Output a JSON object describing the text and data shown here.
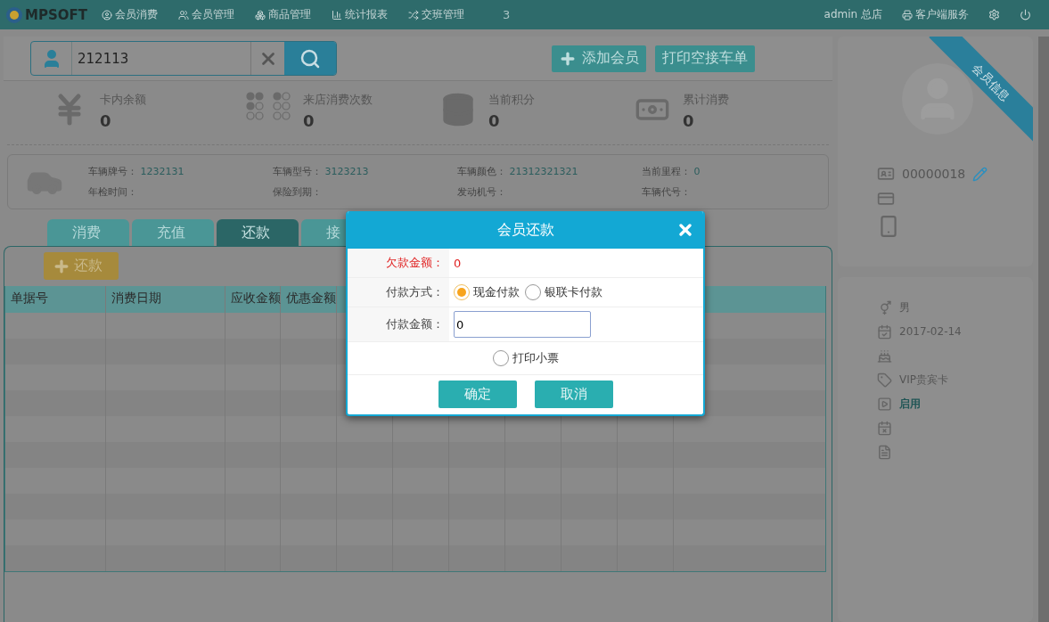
{
  "nav": {
    "logo": "MPSOFT",
    "items": [
      {
        "label": "会员消费"
      },
      {
        "label": "会员管理"
      },
      {
        "label": "商品管理"
      },
      {
        "label": "统计报表"
      },
      {
        "label": "交班管理"
      }
    ],
    "badge": "3",
    "user": "admin 总店",
    "client_service": "客户端服务"
  },
  "search": {
    "value": "212113"
  },
  "actions": [
    "添加会员",
    "打印空接车单"
  ],
  "stats": [
    {
      "kind": "balance",
      "label": "卡内余额",
      "value": "0"
    },
    {
      "kind": "visits",
      "label": "来店消费次数",
      "value": "0"
    },
    {
      "kind": "points",
      "label": "当前积分",
      "value": "0"
    },
    {
      "kind": "spent",
      "label": "累计消费",
      "value": "0"
    }
  ],
  "vehicle": {
    "fields": [
      {
        "label": "车辆牌号：",
        "value": "1232131"
      },
      {
        "label": "车辆型号：",
        "value": "3123213"
      },
      {
        "label": "车辆颜色：",
        "value": "21312321321"
      },
      {
        "label": "当前里程：",
        "value": "0"
      },
      {
        "label": "年检时间："
      },
      {
        "label": "保险到期："
      },
      {
        "label": "发动机号："
      },
      {
        "label": "车辆代号："
      }
    ]
  },
  "tabs": [
    {
      "label": "消费",
      "selected": false
    },
    {
      "label": "充值",
      "selected": false
    },
    {
      "label": "还款",
      "selected": true
    },
    {
      "label": "接",
      "selected": false
    }
  ],
  "repay_button": "还款",
  "table": {
    "columns": [
      "单据号",
      "消费日期",
      "应收金额",
      "优惠金额"
    ]
  },
  "member": {
    "ribbon": "会员信息",
    "top_rows": [
      {
        "kind": "id",
        "text": "00000018"
      },
      {
        "kind": "card"
      },
      {
        "kind": "phone"
      }
    ],
    "rows": [
      {
        "kind": "gender",
        "text": "男"
      },
      {
        "kind": "birthday",
        "text": "2017-02-14"
      },
      {
        "kind": "cake"
      },
      {
        "kind": "card_type",
        "text": "VIP贵宾卡"
      },
      {
        "kind": "status",
        "text": "启用"
      },
      {
        "kind": "expiry"
      },
      {
        "kind": "note"
      }
    ]
  },
  "dialog": {
    "title": "会员还款",
    "debt_label": "欠款金额：",
    "debt_value": "0",
    "method_label": "付款方式：",
    "methods": [
      {
        "label": "现金付款",
        "selected": true
      },
      {
        "label": "银联卡付款",
        "selected": false
      }
    ],
    "amount_label": "付款金额：",
    "amount_value": "0",
    "print_receipt": {
      "label": "打印小票",
      "checked": false
    },
    "buttons": [
      "确定",
      "取消"
    ]
  }
}
